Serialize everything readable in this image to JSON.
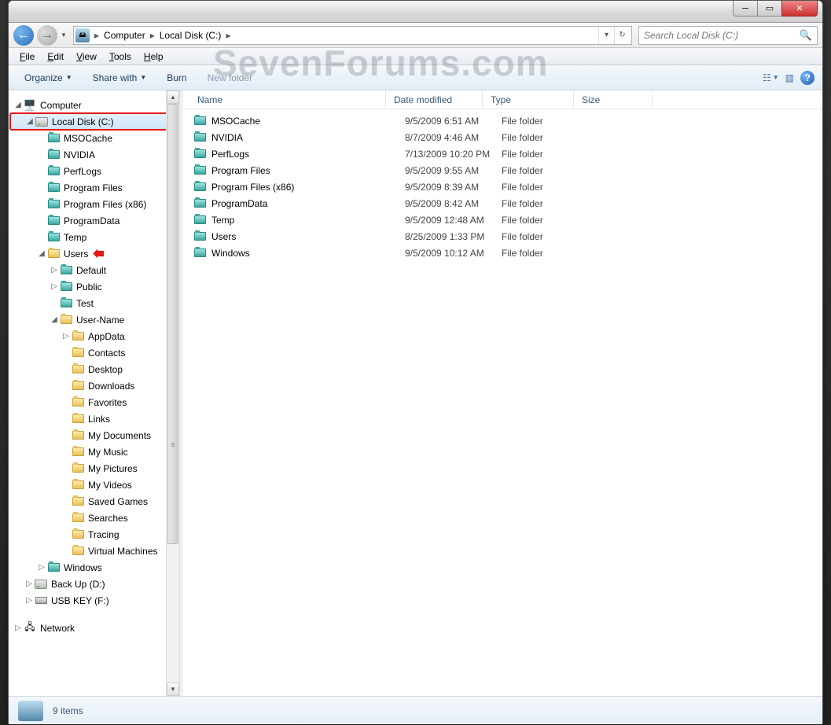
{
  "watermark": "SevenForums.com",
  "breadcrumb": {
    "root": "Computer",
    "location": "Local Disk (C:)"
  },
  "search": {
    "placeholder": "Search Local Disk (C:)"
  },
  "menubar": [
    "File",
    "Edit",
    "View",
    "Tools",
    "Help"
  ],
  "toolbar": {
    "organize": "Organize",
    "share": "Share with",
    "burn": "Burn",
    "newfolder": "New folder"
  },
  "sidebar": {
    "computer": "Computer",
    "localdisk": "Local Disk (C:)",
    "c_children": [
      "MSOCache",
      "NVIDIA",
      "PerfLogs",
      "Program Files",
      "Program Files (x86)",
      "ProgramData",
      "Temp"
    ],
    "users": "Users",
    "users_children": [
      "Default",
      "Public",
      "Test"
    ],
    "username": "User-Name",
    "username_children": [
      "AppData",
      "Contacts",
      "Desktop",
      "Downloads",
      "Favorites",
      "Links",
      "My Documents",
      "My Music",
      "My Pictures",
      "My Videos",
      "Saved Games",
      "Searches",
      "Tracing",
      "Virtual Machines"
    ],
    "windows": "Windows",
    "backup": "Back Up (D:)",
    "usbkey": "USB KEY (F:)",
    "network": "Network"
  },
  "columns": {
    "name": "Name",
    "date": "Date modified",
    "type": "Type",
    "size": "Size"
  },
  "files": [
    {
      "name": "MSOCache",
      "date": "9/5/2009 6:51 AM",
      "type": "File folder"
    },
    {
      "name": "NVIDIA",
      "date": "8/7/2009 4:46 AM",
      "type": "File folder"
    },
    {
      "name": "PerfLogs",
      "date": "7/13/2009 10:20 PM",
      "type": "File folder"
    },
    {
      "name": "Program Files",
      "date": "9/5/2009 9:55 AM",
      "type": "File folder"
    },
    {
      "name": "Program Files (x86)",
      "date": "9/5/2009 8:39 AM",
      "type": "File folder"
    },
    {
      "name": "ProgramData",
      "date": "9/5/2009 8:42 AM",
      "type": "File folder"
    },
    {
      "name": "Temp",
      "date": "9/5/2009 12:48 AM",
      "type": "File folder"
    },
    {
      "name": "Users",
      "date": "8/25/2009 1:33 PM",
      "type": "File folder"
    },
    {
      "name": "Windows",
      "date": "9/5/2009 10:12 AM",
      "type": "File folder"
    }
  ],
  "status": {
    "count": "9 items"
  }
}
